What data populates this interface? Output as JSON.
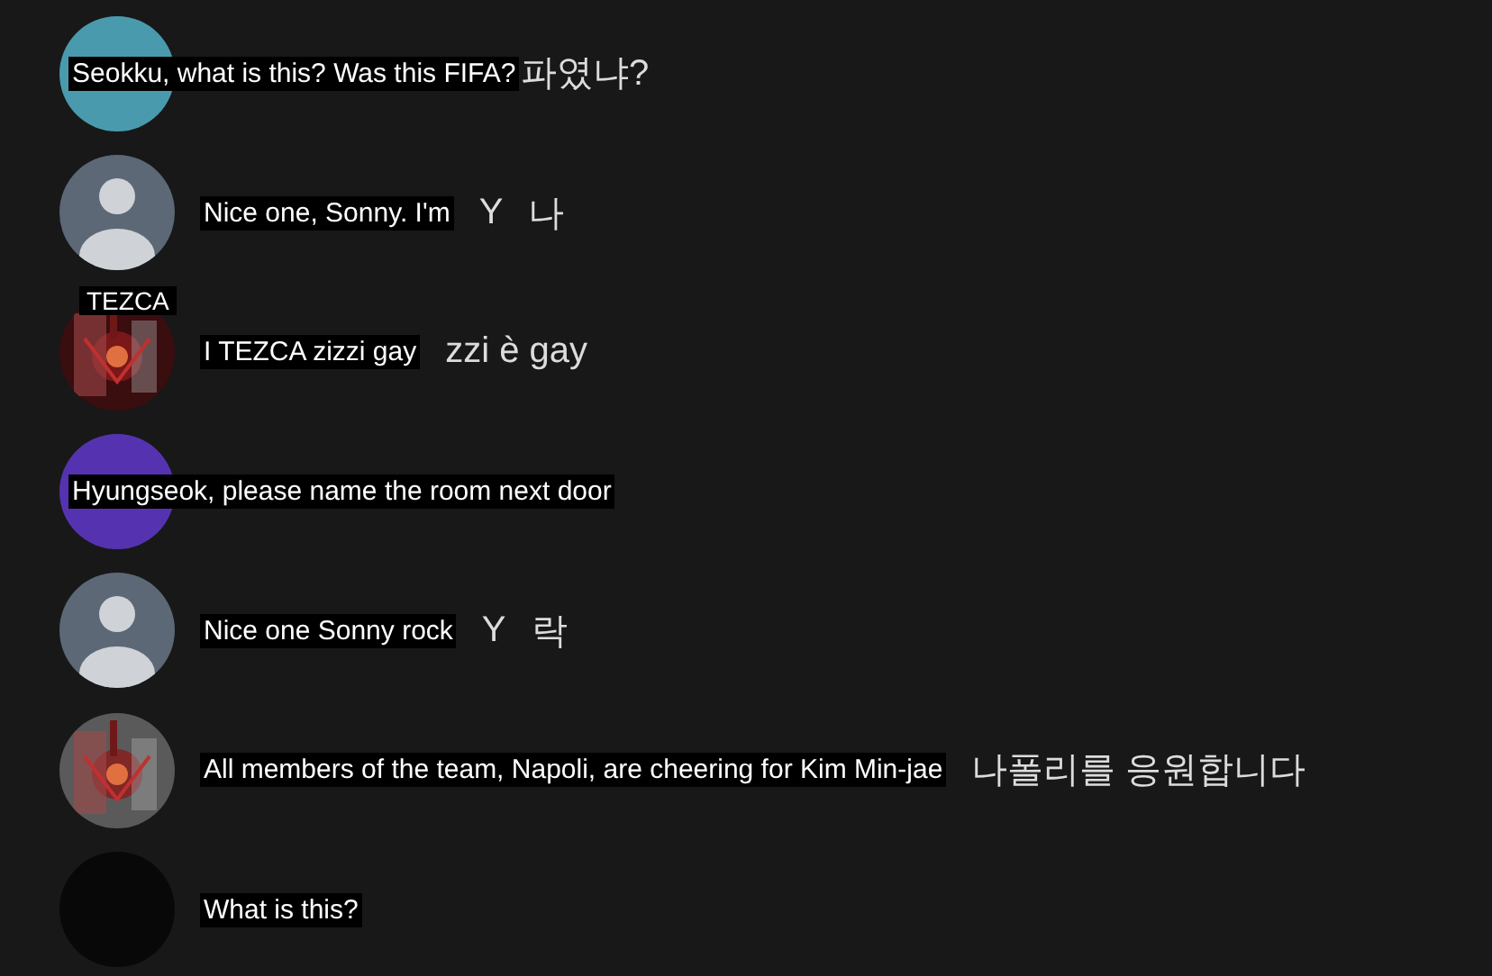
{
  "comments": [
    {
      "kind": "overlay",
      "avatar": {
        "kind": "solid",
        "color": "#4a9aae"
      },
      "translation": "Seokku, what is this? Was this FIFA?",
      "original_tail": [
        "파였냐?"
      ]
    },
    {
      "kind": "inline",
      "avatar": {
        "kind": "person",
        "color": "#5d6876"
      },
      "translation": "Nice one, Sonny. I'm",
      "original_tail": [
        "Y",
        "나"
      ]
    },
    {
      "kind": "inline",
      "avatar": {
        "kind": "picture"
      },
      "name_label": "TEZCA",
      "translation": "I TEZCA zizzi  gay",
      "original_tail": [
        "zzi è gay"
      ]
    },
    {
      "kind": "overlay",
      "avatar": {
        "kind": "solid",
        "color": "#5533b0"
      },
      "translation": "Hyungseok, please name the room next door"
    },
    {
      "kind": "inline",
      "avatar": {
        "kind": "person",
        "color": "#5d6876"
      },
      "translation": "Nice one Sonny rock",
      "original_tail": [
        "Y",
        "락"
      ]
    },
    {
      "kind": "inline",
      "avatar": {
        "kind": "picture"
      },
      "translation": "All members of the team, Napoli, are cheering for Kim Min-jae",
      "original_tail": [
        "나폴리를 응원합니다"
      ]
    },
    {
      "kind": "inline",
      "avatar": {
        "kind": "solid",
        "color": "#080808"
      },
      "translation": "What is this?"
    }
  ]
}
